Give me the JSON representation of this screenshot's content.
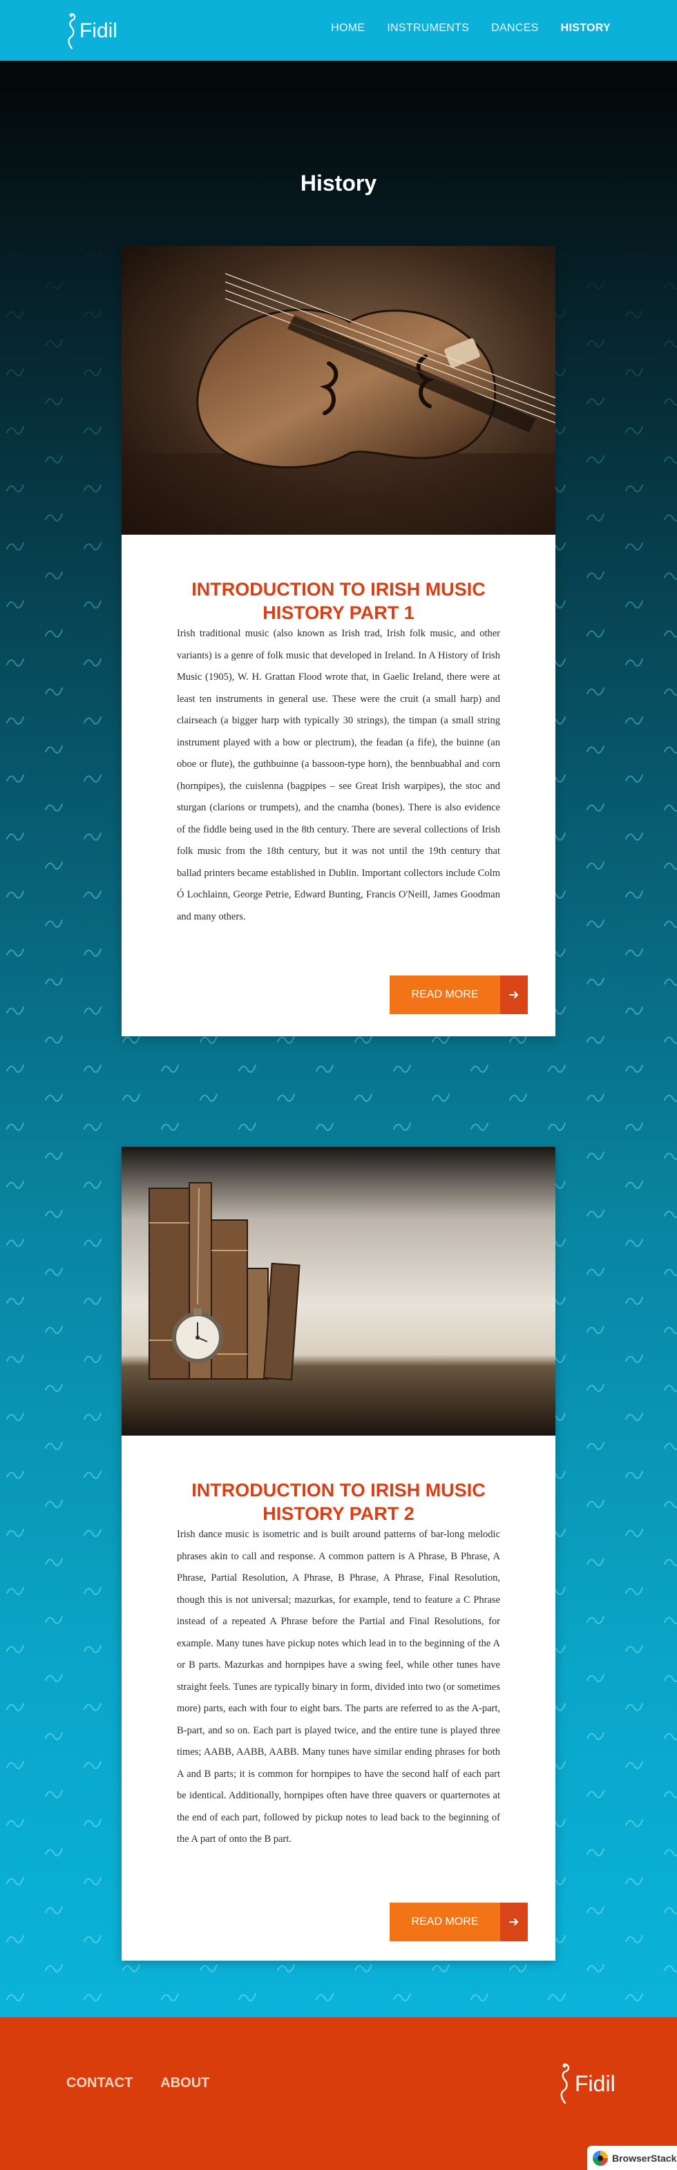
{
  "brand": {
    "name": "Fidil"
  },
  "nav": {
    "items": [
      {
        "label": "HOME"
      },
      {
        "label": "INSTRUMENTS"
      },
      {
        "label": "DANCES"
      },
      {
        "label": "HISTORY",
        "active": true
      }
    ]
  },
  "page": {
    "title": "History"
  },
  "articles": [
    {
      "image": "violin-photo",
      "title": "INTRODUCTION TO IRISH MUSIC HISTORY PART 1",
      "body": "Irish traditional music (also known as Irish trad, Irish folk music, and other variants) is a genre of folk music that developed in Ireland. In A History of Irish Music (1905), W. H. Grattan Flood wrote that, in Gaelic Ireland, there were at least ten instruments in general use. These were the cruit (a small harp) and clairseach (a bigger harp with typically 30 strings), the timpan (a small string instrument played with a bow or plectrum), the feadan (a fife), the buinne (an oboe or flute), the guthbuinne (a bassoon-type horn), the bennbuabhal and corn (hornpipes), the cuislenna (bagpipes – see Great Irish warpipes), the stoc and sturgan (clarions or trumpets), and the cnamha (bones). There is also evidence of the fiddle being used in the 8th century. There are several collections of Irish folk music from the 18th century, but it was not until the 19th century that ballad printers became established in Dublin. Important collectors include Colm Ó Lochlainn, George Petrie, Edward Bunting, Francis O'Neill, James Goodman and many others.",
      "button": "READ MORE"
    },
    {
      "image": "books-and-pocket-watch-photo",
      "title": "INTRODUCTION TO IRISH MUSIC HISTORY PART 2",
      "body": "Irish dance music is isometric and is built around patterns of bar-long melodic phrases akin to call and response. A common pattern is A Phrase, B Phrase, A Phrase, Partial Resolution, A Phrase, B Phrase, A Phrase, Final Resolution, though this is not universal; mazurkas, for example, tend to feature a C Phrase instead of a repeated A Phrase before the Partial and Final Resolutions, for example. Many tunes have pickup notes which lead in to the beginning of the A or B parts. Mazurkas and hornpipes have a swing feel, while other tunes have straight feels. Tunes are typically binary in form, divided into two (or sometimes more) parts, each with four to eight bars. The parts are referred to as the A-part, B-part, and so on. Each part is played twice, and the entire tune is played three times; AABB, AABB, AABB. Many tunes have similar ending phrases for both A and B parts; it is common for hornpipes to have the second half of each part be identical. Additionally, hornpipes often have three quavers or quarternotes at the end of each part, followed by pickup notes to lead back to the beginning of the A part of onto the B part.",
      "button": "READ MORE"
    }
  ],
  "footer": {
    "links": [
      {
        "label": "CONTACT"
      },
      {
        "label": "ABOUT"
      }
    ],
    "logo_text": "Fidil"
  },
  "badge": {
    "label": "BrowserStack"
  },
  "colors": {
    "header": "#0bb1d9",
    "title_accent": "#dd3d10",
    "button": "#f37317",
    "button_arrow": "#d94517",
    "footer": "#d93d0c"
  }
}
